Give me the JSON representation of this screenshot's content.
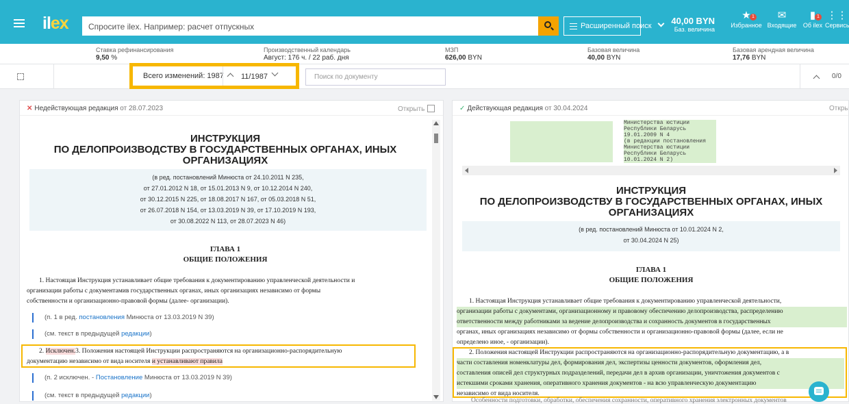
{
  "header": {
    "logo_text": "il",
    "logo_x": "ex",
    "search_placeholder": "Спросите ilex. Например: расчет отпускных",
    "advanced_search": "Расширенный поиск",
    "base_value_amount": "40,00 BYN",
    "base_value_label": "Баз. величина",
    "nav": [
      {
        "label": "Избранное",
        "icon": "star-icon",
        "badge": "1"
      },
      {
        "label": "Входящие",
        "icon": "mail-icon",
        "badge": ""
      },
      {
        "label": "Об ilex",
        "icon": "info-icon",
        "badge": "1"
      },
      {
        "label": "Сервисы",
        "icon": "grid-icon",
        "badge": ""
      }
    ],
    "accent": "#2ab3cf"
  },
  "infobar": {
    "items": [
      {
        "label": "Ставка рефинансирования",
        "value": "9,50",
        "unit": "%"
      },
      {
        "label": "Производственный календарь",
        "value": "Август: 176 ч. / 22 раб. дня",
        "unit": ""
      },
      {
        "label": "МЗП",
        "value": "626,00",
        "unit": "BYN"
      },
      {
        "label": "Базовая величина",
        "value": "40,00",
        "unit": "BYN"
      },
      {
        "label": "Базовая арендная величина",
        "value": "17,76",
        "unit": "BYN"
      }
    ]
  },
  "toolbar": {
    "total_changes": "Всего изменений: 1987",
    "position": "11/1987",
    "doc_search_placeholder": "Поиск по документу",
    "right_count": "0/0"
  },
  "left": {
    "status": "Недействующая редакция",
    "date": "от 28.07.2023",
    "open": "Открыть",
    "title_1": "ИНСТРУКЦИЯ",
    "title_2": "ПО ДЕЛОПРОИЗВОДСТВУ В ГОСУДАРСТВЕННЫХ ОРГАНАХ, ИНЫХ",
    "title_3": "ОРГАНИЗАЦИЯХ",
    "editions": [
      "(в ред. постановлений Минюста от 24.10.2011 N 235,",
      "от 27.01.2012 N 18, от 15.01.2013 N 9, от 10.12.2014 N 240,",
      "от 30.12.2015 N 225, от 18.08.2017 N 167, от 05.03.2018 N 51,",
      "от 26.07.2018 N 154, от 13.03.2019 N 39, от 17.10.2019 N 193,",
      "от 30.08.2022 N 113, от 28.07.2023 N 46)"
    ],
    "chapter": "ГЛАВА 1",
    "chapter_title": "ОБЩИЕ ПОЛОЖЕНИЯ",
    "p1_line1": "1. Настоящая Инструкция устанавливает общие требования к документированию управленческой деятельности и",
    "p1_line2": "организации работы с документамив государственных органах, иных организациях независимо от формы",
    "p1_line3": "собственности и организационно-правовой формы (далее- организации).",
    "ref1_text": "(п. 1 в ред. ",
    "ref1_link": "постановления",
    "ref1_tail": " Минюста от 13.03.2019 N 39)",
    "ref2_text": "(см. текст в предыдущей ",
    "ref2_link": "редакции",
    "ref2_tail": ")",
    "p2_line1_a": "2. ",
    "p2_line1_del": "Исключен.",
    "p2_line1_b": "3. Положения настоящей Инструкции распространяются на организационно-распорядительную",
    "p2_line2_a": "документацию независимо от вида носителя ",
    "p2_line2_del": "и устанавливают правила",
    "ref3_text": "(п. 2 исключен. - ",
    "ref3_link": "Постановление",
    "ref3_tail": " Минюста от 13.03.2019 N 39)",
    "ref4_text": "(см. текст в предыдущей ",
    "ref4_link": "редакции",
    "ref4_tail": ")"
  },
  "right": {
    "status": "Действующая редакция",
    "date": "от 30.04.2024",
    "open": "Открыть",
    "mono": [
      "Министерства юстиции",
      "Республики Беларусь",
      "19.01.2009 N 4",
      "(в редакции постановления",
      "Министерства юстиции",
      "Республики Беларусь",
      "10.01.2024 N 2)"
    ],
    "title_1": "ИНСТРУКЦИЯ",
    "title_2": "ПО ДЕЛОПРОИЗВОДСТВУ В ГОСУДАРСТВЕННЫХ ОРГАНАХ, ИНЫХ",
    "title_3": "ОРГАНИЗАЦИЯХ",
    "editions": [
      "(в ред. постановлений Минюста от 10.01.2024 N 2,",
      "от 30.04.2024 N 25)"
    ],
    "chapter": "ГЛАВА 1",
    "chapter_title": "ОБЩИЕ ПОЛОЖЕНИЯ",
    "p1_line1": "1. Настоящая Инструкция устанавливает общие требования к документированию управленческой деятельности,",
    "p1_line2": "организации работы с документами, организационному и правовому обеспечению делопроизводства, распределению",
    "p1_line3": "ответственности между работниками за ведение делопроизводства и сохранность документов в государственных",
    "p1_line4": "органах, иных организациях независимо от формы собственности и организационно-правовой формы (далее, если не",
    "p1_line5": "определено иное, - организации).",
    "p2_line1": "2. Положения настоящей Инструкции распространяются на организационно-распорядительную документацию, а в",
    "p2_line2": "части составления номенклатуры дел, формирования дел, экспертизы ценности документов, оформления дел,",
    "p2_line3": "составления описей дел структурных подразделений, передачи дел в архив организации, уничтожения документов с",
    "p2_line4": "истекшими сроками хранения, оперативного хранения документов - на всю управленческую документацию",
    "p2_line5": "независимо от вида носителя.",
    "p3_fade": "Особенности подготовки, обработки, обеспечения сохранности, оперативного хранения электронных документов"
  }
}
